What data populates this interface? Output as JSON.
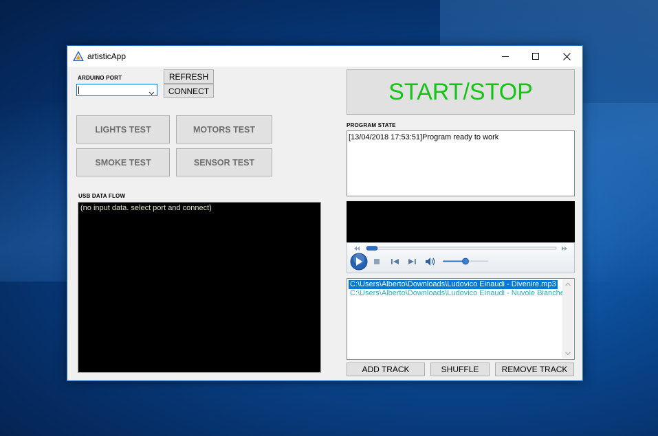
{
  "window": {
    "title": "artisticApp"
  },
  "arduino": {
    "port_label": "ARDUINO PORT",
    "port_value": "",
    "refresh_label": "REFRESH",
    "connect_label": "CONNECT"
  },
  "tests": {
    "lights": "LIGHTS TEST",
    "motors": "MOTORS TEST",
    "smoke": "SMOKE TEST",
    "sensor": "SENSOR TEST"
  },
  "usb": {
    "label": "USB DATA FLOW",
    "text": "(no input data. select port and connect)"
  },
  "start_stop_label": "START/STOP",
  "program_state": {
    "label": "PROGRAM STATE",
    "log": "[13/04/2018 17:53:51]Program ready to work"
  },
  "player": {
    "seek_progress": 0.0,
    "volume_level": 0.5
  },
  "playlist": {
    "tracks": [
      "C:\\Users\\Alberto\\Downloads\\Ludovico Einaudi - Divenire.mp3",
      "C:\\Users\\Alberto\\Downloads\\Ludovico Einaudi - Nuvole Bianche"
    ],
    "selected_index": 0,
    "add_label": "ADD TRACK",
    "shuffle_label": "SHUFFLE",
    "remove_label": "REMOVE TRACK"
  },
  "colors": {
    "start_text": "#14c414",
    "selection": "#0078d7",
    "track_text": "#27b4b4",
    "usb_text": "#dbe6c8"
  }
}
